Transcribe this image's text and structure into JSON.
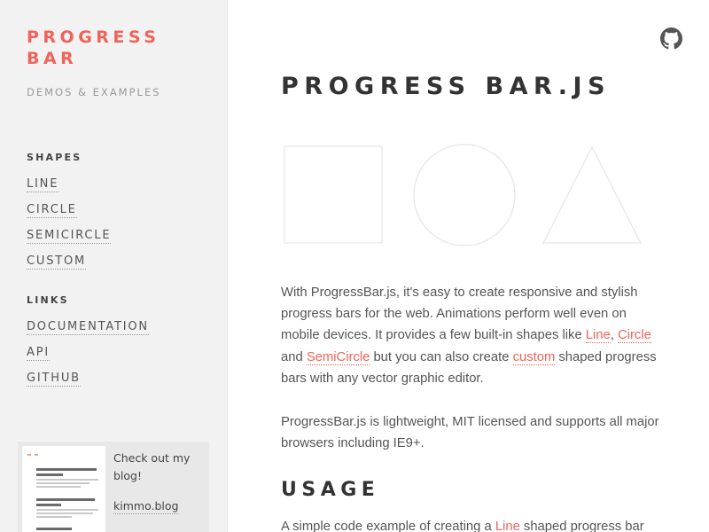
{
  "sidebar": {
    "brand_line1": "PROGRESS",
    "brand_line2": "BAR",
    "tagline": "DEMOS & EXAMPLES",
    "shapes_heading": "SHAPES",
    "shapes": [
      "LINE",
      "CIRCLE",
      "SEMICIRCLE",
      "CUSTOM"
    ],
    "links_heading": "LINKS",
    "links": [
      "DOCUMENTATION",
      "API",
      "GITHUB"
    ],
    "blog": {
      "text": "Check out my blog!",
      "link": "kimmo.blog"
    }
  },
  "header": {
    "github_icon": "github-icon"
  },
  "main": {
    "title": "PROGRESS BAR.JS",
    "intro": {
      "t1": "With ProgressBar.js, it's easy to create responsive and stylish progress bars for the web. Animations perform well even on mobile devices. It provides a few built-in shapes like ",
      "l1": "Line",
      "t2": ", ",
      "l2": "Circle",
      "t3": " and ",
      "l3": "SemiCircle",
      "t4": " but you can also create ",
      "l4": "custom",
      "t5": " shaped progress bars with any vector graphic editor."
    },
    "para2": "ProgressBar.js is lightweight, MIT licensed and supports all major browsers including IE9+.",
    "usage_heading": "USAGE",
    "usage": {
      "t1": "A simple code example of creating a ",
      "l1": "Line",
      "t2": " shaped progress bar and"
    }
  },
  "colors": {
    "accent": "#f0635a",
    "sidebar_bg": "#f2f2f2",
    "heading": "#333333",
    "text": "#555555"
  }
}
